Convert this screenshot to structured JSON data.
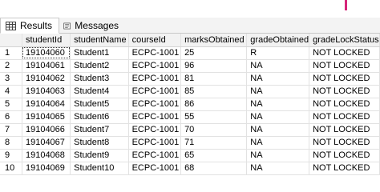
{
  "tabs": [
    {
      "label": "Results",
      "icon": "grid-icon",
      "active": true
    },
    {
      "label": "Messages",
      "icon": "messages-icon",
      "active": false
    }
  ],
  "grid": {
    "columns": [
      "studentId",
      "studentName",
      "courseId",
      "marksObtained",
      "gradeObtained",
      "gradeLockStatus"
    ],
    "rows": [
      {
        "num": "1",
        "cells": [
          "19104060",
          "Student1",
          "ECPC-1001",
          "25",
          "R",
          "NOT LOCKED"
        ]
      },
      {
        "num": "2",
        "cells": [
          "19104061",
          "Student2",
          "ECPC-1001",
          "96",
          "NA",
          "NOT LOCKED"
        ]
      },
      {
        "num": "3",
        "cells": [
          "19104062",
          "Student3",
          "ECPC-1001",
          "81",
          "NA",
          "NOT LOCKED"
        ]
      },
      {
        "num": "4",
        "cells": [
          "19104063",
          "Student4",
          "ECPC-1001",
          "85",
          "NA",
          "NOT LOCKED"
        ]
      },
      {
        "num": "5",
        "cells": [
          "19104064",
          "Student5",
          "ECPC-1001",
          "86",
          "NA",
          "NOT LOCKED"
        ]
      },
      {
        "num": "6",
        "cells": [
          "19104065",
          "Student6",
          "ECPC-1001",
          "55",
          "NA",
          "NOT LOCKED"
        ]
      },
      {
        "num": "7",
        "cells": [
          "19104066",
          "Student7",
          "ECPC-1001",
          "70",
          "NA",
          "NOT LOCKED"
        ]
      },
      {
        "num": "8",
        "cells": [
          "19104067",
          "Student8",
          "ECPC-1001",
          "71",
          "NA",
          "NOT LOCKED"
        ]
      },
      {
        "num": "9",
        "cells": [
          "19104068",
          "Student9",
          "ECPC-1001",
          "65",
          "NA",
          "NOT LOCKED"
        ]
      },
      {
        "num": "10",
        "cells": [
          "19104069",
          "Student10",
          "ECPC-1001",
          "68",
          "NA",
          "NOT LOCKED"
        ]
      }
    ]
  },
  "colors": {
    "accent_mark": "#d6257a",
    "grid_line": "#e2e2e2",
    "header_bg": "#f2f2f2"
  }
}
